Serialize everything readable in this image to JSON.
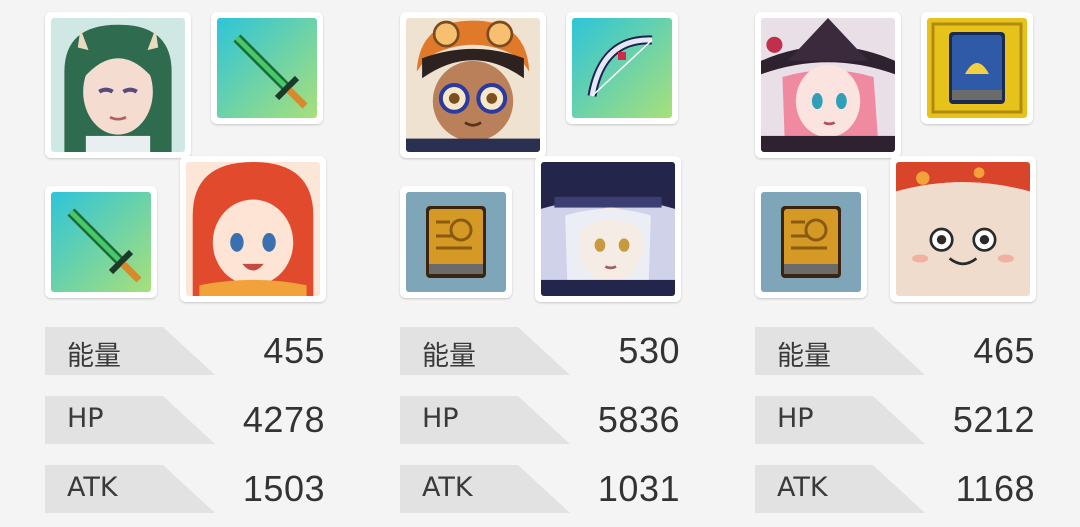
{
  "teams": [
    {
      "characters": [
        {
          "icon": "green-haired-horned-woman-portrait-icon"
        },
        {
          "icon": "red-haired-girl-portrait-icon"
        }
      ],
      "items": [
        {
          "icon": "green-sword-weapon-icon"
        },
        {
          "icon": "green-sword-weapon-icon"
        }
      ],
      "stats": [
        {
          "label": "能量",
          "value": "455"
        },
        {
          "label": "HP",
          "value": "4278"
        },
        {
          "label": "ATK",
          "value": "1503"
        }
      ]
    },
    {
      "characters": [
        {
          "icon": "boy-with-goggles-and-glasses-portrait-icon"
        },
        {
          "icon": "white-haired-girl-dark-hat-portrait-icon"
        }
      ],
      "items": [
        {
          "icon": "silver-bow-weapon-icon"
        },
        {
          "icon": "golden-book-item-icon"
        }
      ],
      "stats": [
        {
          "label": "能量",
          "value": "530"
        },
        {
          "label": "HP",
          "value": "5836"
        },
        {
          "label": "ATK",
          "value": "1031"
        }
      ]
    },
    {
      "characters": [
        {
          "icon": "pink-haired-witch-portrait-icon"
        },
        {
          "icon": "mushroom-creature-portrait-icon"
        }
      ],
      "items": [
        {
          "icon": "blue-tome-gold-frame-item-icon"
        },
        {
          "icon": "golden-book-item-icon"
        }
      ],
      "stats": [
        {
          "label": "能量",
          "value": "465"
        },
        {
          "label": "HP",
          "value": "5212"
        },
        {
          "label": "ATK",
          "value": "1168"
        }
      ]
    }
  ]
}
